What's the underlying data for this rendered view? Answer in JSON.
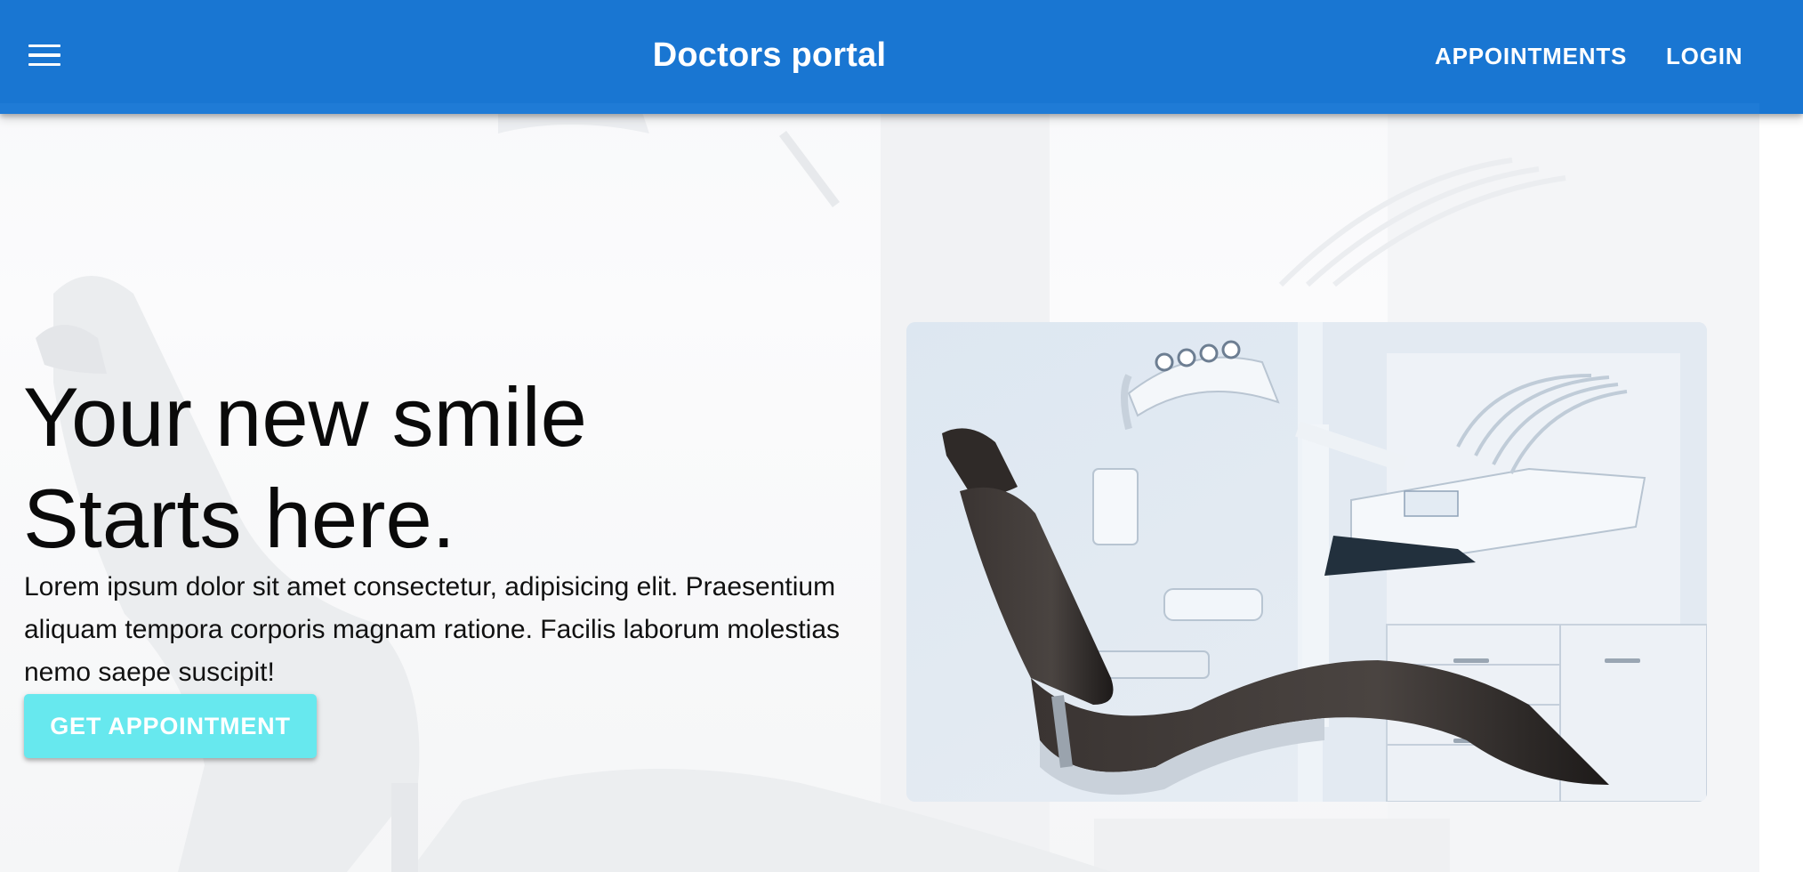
{
  "appbar": {
    "title": "Doctors portal",
    "menu_icon": "hamburger-menu-icon",
    "nav": [
      {
        "label": "APPOINTMENTS"
      },
      {
        "label": "LOGIN"
      }
    ],
    "color": "#1976d2"
  },
  "hero": {
    "title_line1": "Your new smile",
    "title_line2": "Starts here.",
    "description": "Lorem ipsum dolor sit amet consectetur, adipisicing elit. Praesentium aliquam tempora corporis magnam ratione. Facilis laborum molestias nemo saepe suscipit!",
    "cta_label": "GET APPOINTMENT",
    "cta_color": "#67e8ee",
    "image_subject": "dental-chair-photo"
  }
}
